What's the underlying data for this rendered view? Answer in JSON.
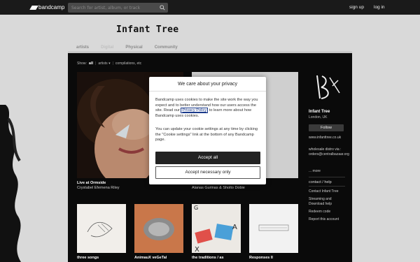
{
  "header": {
    "logo_text": "bandcamp",
    "search_placeholder": "Search for artist, album, or track",
    "signup": "sign up",
    "login": "log in"
  },
  "artist": {
    "name": "Infant Tree",
    "tabs": [
      "artists",
      "Digital",
      "Physical",
      "Community"
    ]
  },
  "filters": {
    "label": "Show:",
    "all": "all",
    "artists": "artists ▾",
    "compilations": "compilations, etc"
  },
  "releases": [
    {
      "title": "Live at Ormside",
      "artist": "Crystabel Efemena Riley"
    },
    {
      "title": "",
      "artist": "Alanas Gurinas & Sholto Dobie"
    },
    {
      "title": "three songs",
      "artist": ""
    },
    {
      "title": "AnimauX veGeTal",
      "artist": ""
    },
    {
      "title": "the traditions / as",
      "artist": ""
    },
    {
      "title": "Responses II",
      "artist": ""
    }
  ],
  "sidebar": {
    "name": "Infant Tree",
    "location": "London, UK",
    "follow": "Follow",
    "website": "www.infanttree.co.uk",
    "distro": "wholesale distro via : orders@centralbazaar.org",
    "more": "... more",
    "section_title": "contact / help",
    "links": [
      "Contact Infant Tree",
      "Streaming and Download help",
      "Redeem code",
      "Report this account"
    ]
  },
  "cookie_modal": {
    "title": "We care about your privacy",
    "p1_before": "Bandcamp uses cookies to make the site work the way you expect and to better understand how our users access the site. Read our ",
    "p1_link": "Privacy Policy",
    "p1_after": " to learn more about how Bandcamp uses cookies.",
    "p2": "You can update your cookie settings at any time by clicking the \"Cookie settings\" link at the bottom of any Bandcamp page.",
    "accept_all": "Accept all",
    "accept_necessary": "Accept necessary only"
  }
}
